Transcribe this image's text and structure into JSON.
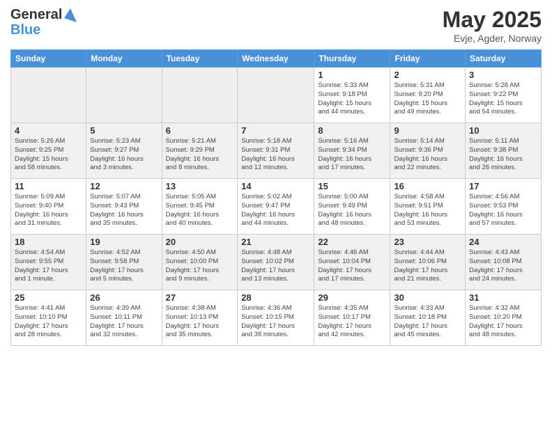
{
  "header": {
    "logo_line1": "General",
    "logo_line2": "Blue",
    "month": "May 2025",
    "location": "Evje, Agder, Norway"
  },
  "days_of_week": [
    "Sunday",
    "Monday",
    "Tuesday",
    "Wednesday",
    "Thursday",
    "Friday",
    "Saturday"
  ],
  "weeks": [
    [
      {
        "day": "",
        "info": ""
      },
      {
        "day": "",
        "info": ""
      },
      {
        "day": "",
        "info": ""
      },
      {
        "day": "",
        "info": ""
      },
      {
        "day": "1",
        "info": "Sunrise: 5:33 AM\nSunset: 9:18 PM\nDaylight: 15 hours\nand 44 minutes."
      },
      {
        "day": "2",
        "info": "Sunrise: 5:31 AM\nSunset: 9:20 PM\nDaylight: 15 hours\nand 49 minutes."
      },
      {
        "day": "3",
        "info": "Sunrise: 5:28 AM\nSunset: 9:22 PM\nDaylight: 15 hours\nand 54 minutes."
      }
    ],
    [
      {
        "day": "4",
        "info": "Sunrise: 5:26 AM\nSunset: 9:25 PM\nDaylight: 15 hours\nand 58 minutes."
      },
      {
        "day": "5",
        "info": "Sunrise: 5:23 AM\nSunset: 9:27 PM\nDaylight: 16 hours\nand 3 minutes."
      },
      {
        "day": "6",
        "info": "Sunrise: 5:21 AM\nSunset: 9:29 PM\nDaylight: 16 hours\nand 8 minutes."
      },
      {
        "day": "7",
        "info": "Sunrise: 5:18 AM\nSunset: 9:31 PM\nDaylight: 16 hours\nand 12 minutes."
      },
      {
        "day": "8",
        "info": "Sunrise: 5:16 AM\nSunset: 9:34 PM\nDaylight: 16 hours\nand 17 minutes."
      },
      {
        "day": "9",
        "info": "Sunrise: 5:14 AM\nSunset: 9:36 PM\nDaylight: 16 hours\nand 22 minutes."
      },
      {
        "day": "10",
        "info": "Sunrise: 5:11 AM\nSunset: 9:38 PM\nDaylight: 16 hours\nand 26 minutes."
      }
    ],
    [
      {
        "day": "11",
        "info": "Sunrise: 5:09 AM\nSunset: 9:40 PM\nDaylight: 16 hours\nand 31 minutes."
      },
      {
        "day": "12",
        "info": "Sunrise: 5:07 AM\nSunset: 9:43 PM\nDaylight: 16 hours\nand 35 minutes."
      },
      {
        "day": "13",
        "info": "Sunrise: 5:05 AM\nSunset: 9:45 PM\nDaylight: 16 hours\nand 40 minutes."
      },
      {
        "day": "14",
        "info": "Sunrise: 5:02 AM\nSunset: 9:47 PM\nDaylight: 16 hours\nand 44 minutes."
      },
      {
        "day": "15",
        "info": "Sunrise: 5:00 AM\nSunset: 9:49 PM\nDaylight: 16 hours\nand 48 minutes."
      },
      {
        "day": "16",
        "info": "Sunrise: 4:58 AM\nSunset: 9:51 PM\nDaylight: 16 hours\nand 53 minutes."
      },
      {
        "day": "17",
        "info": "Sunrise: 4:56 AM\nSunset: 9:53 PM\nDaylight: 16 hours\nand 57 minutes."
      }
    ],
    [
      {
        "day": "18",
        "info": "Sunrise: 4:54 AM\nSunset: 9:55 PM\nDaylight: 17 hours\nand 1 minute."
      },
      {
        "day": "19",
        "info": "Sunrise: 4:52 AM\nSunset: 9:58 PM\nDaylight: 17 hours\nand 5 minutes."
      },
      {
        "day": "20",
        "info": "Sunrise: 4:50 AM\nSunset: 10:00 PM\nDaylight: 17 hours\nand 9 minutes."
      },
      {
        "day": "21",
        "info": "Sunrise: 4:48 AM\nSunset: 10:02 PM\nDaylight: 17 hours\nand 13 minutes."
      },
      {
        "day": "22",
        "info": "Sunrise: 4:46 AM\nSunset: 10:04 PM\nDaylight: 17 hours\nand 17 minutes."
      },
      {
        "day": "23",
        "info": "Sunrise: 4:44 AM\nSunset: 10:06 PM\nDaylight: 17 hours\nand 21 minutes."
      },
      {
        "day": "24",
        "info": "Sunrise: 4:43 AM\nSunset: 10:08 PM\nDaylight: 17 hours\nand 24 minutes."
      }
    ],
    [
      {
        "day": "25",
        "info": "Sunrise: 4:41 AM\nSunset: 10:10 PM\nDaylight: 17 hours\nand 28 minutes."
      },
      {
        "day": "26",
        "info": "Sunrise: 4:39 AM\nSunset: 10:11 PM\nDaylight: 17 hours\nand 32 minutes."
      },
      {
        "day": "27",
        "info": "Sunrise: 4:38 AM\nSunset: 10:13 PM\nDaylight: 17 hours\nand 35 minutes."
      },
      {
        "day": "28",
        "info": "Sunrise: 4:36 AM\nSunset: 10:15 PM\nDaylight: 17 hours\nand 38 minutes."
      },
      {
        "day": "29",
        "info": "Sunrise: 4:35 AM\nSunset: 10:17 PM\nDaylight: 17 hours\nand 42 minutes."
      },
      {
        "day": "30",
        "info": "Sunrise: 4:33 AM\nSunset: 10:18 PM\nDaylight: 17 hours\nand 45 minutes."
      },
      {
        "day": "31",
        "info": "Sunrise: 4:32 AM\nSunset: 10:20 PM\nDaylight: 17 hours\nand 48 minutes."
      }
    ]
  ]
}
